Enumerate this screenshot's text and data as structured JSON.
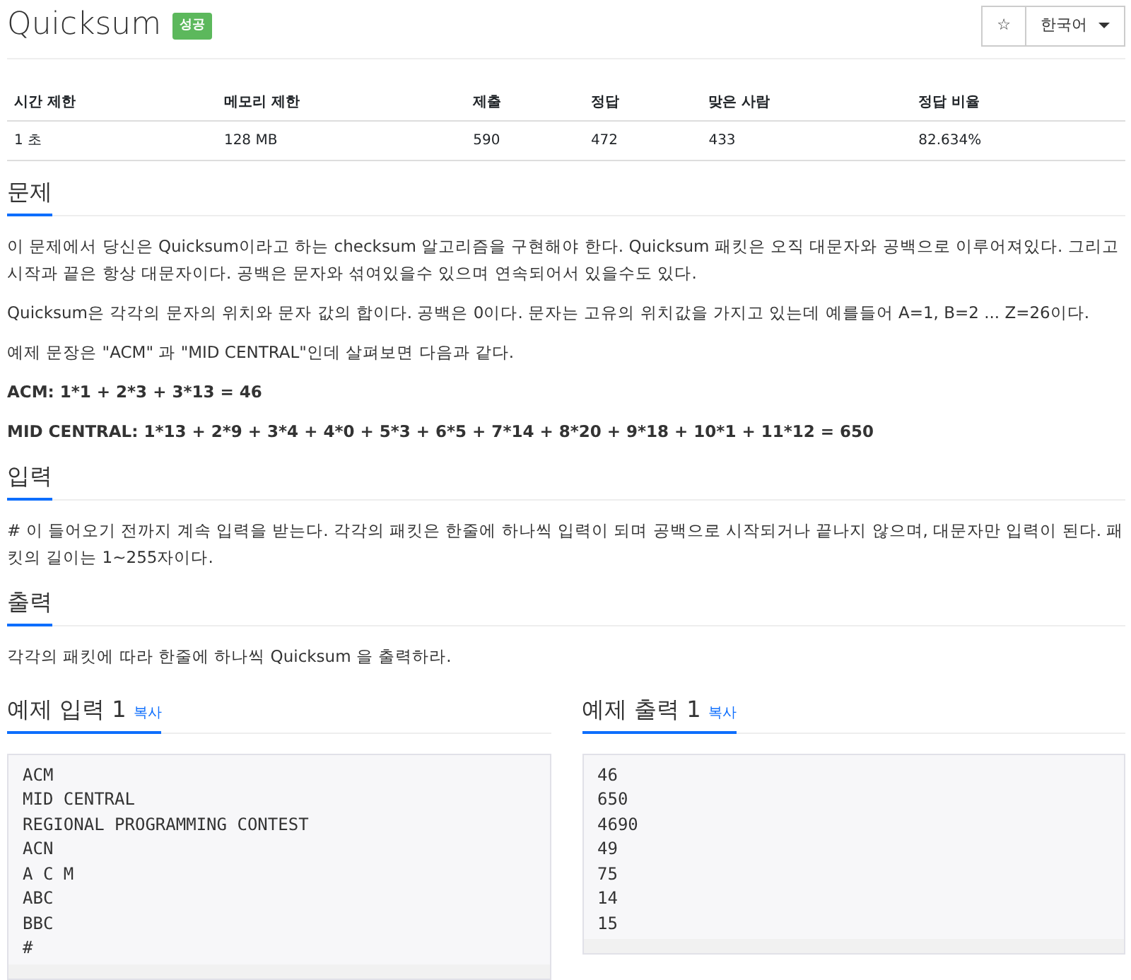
{
  "title": "Quicksum",
  "result_badge": "성공",
  "star_button": "☆",
  "language_dropdown": "한국어",
  "stats_table": {
    "columns": [
      "시간 제한",
      "메모리 제한",
      "제출",
      "정답",
      "맞은 사람",
      "정답 비율"
    ],
    "rows": [
      [
        "1 초",
        "128 MB",
        "590",
        "472",
        "433",
        "82.634%"
      ]
    ]
  },
  "sections": [
    {
      "heading": "문제",
      "paragraphs": [
        {
          "kind": "plain",
          "text": "이 문제에서 당신은 Quicksum이라고 하는 checksum 알고리즘을 구현해야 한다.  Quicksum 패킷은 오직 대문자와 공백으로 이루어져있다. 그리고 시작과 끝은 항상 대문자이다.  공백은 문자와 섞여있을수 있으며 연속되어서 있을수도 있다."
        },
        {
          "kind": "plain",
          "text": "Quicksum은 각각의 문자의 위치와 문자 값의 합이다. 공백은 0이다. 문자는 고유의 위치값을 가지고 있는데 예를들어 A=1, B=2 ... Z=26이다."
        },
        {
          "kind": "plain",
          "text": "예제 문장은 \"ACM\" 과 \"MID CENTRAL\"인데 살펴보면 다음과 같다."
        },
        {
          "kind": "bold",
          "text": "ACM: 1*1  + 2*3 + 3*13 = 46"
        },
        {
          "kind": "bold",
          "text": "MID CENTRAL: 1*13 + 2*9 + 3*4 + 4*0 + 5*3 + 6*5 + 7*14 + 8*20 + 9*18 + 10*1 + 11*12 = 650"
        }
      ]
    },
    {
      "heading": "입력",
      "paragraphs": [
        {
          "kind": "plain",
          "text": "# 이 들어오기 전까지 계속 입력을 받는다. 각각의 패킷은 한줄에 하나씩 입력이 되며 공백으로 시작되거나 끝나지 않으며, 대문자만 입력이 된다. 패킷의 길이는 1~255자이다."
        }
      ]
    },
    {
      "heading": "출력",
      "paragraphs": [
        {
          "kind": "plain",
          "text": "각각의 패킷에 따라 한줄에 하나씩 Quicksum 을 출력하라."
        }
      ]
    }
  ],
  "samples": [
    {
      "heading": "예제 입력 1",
      "copy_link": "복사",
      "lines": [
        "ACM",
        "MID CENTRAL",
        "REGIONAL PROGRAMMING CONTEST",
        "ACN",
        "A C M",
        "ABC",
        "BBC",
        "#"
      ]
    },
    {
      "heading": "예제 출력 1",
      "copy_link": "복사",
      "lines": [
        "46",
        "650",
        "4690",
        "49",
        "75",
        "14",
        "15"
      ]
    }
  ]
}
